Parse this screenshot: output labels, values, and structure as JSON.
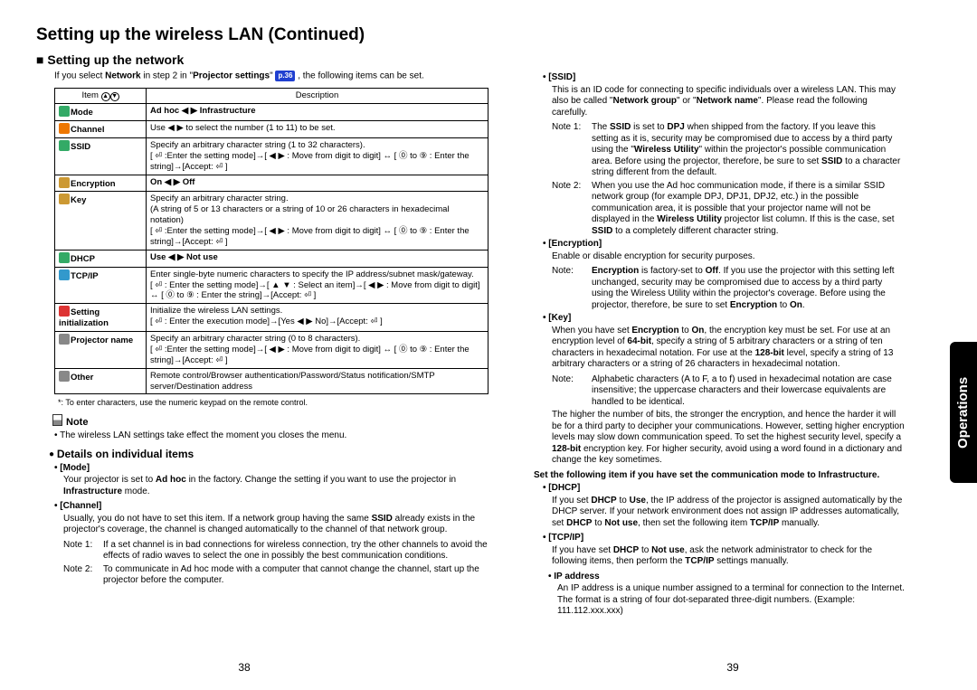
{
  "title": "Setting up the wireless LAN (Continued)",
  "subheading": "Setting up the network",
  "intro_prefix": "If you select ",
  "intro_bold1": "Network",
  "intro_mid": " in step 2 in \"",
  "intro_bold2": "Projector settings",
  "intro_after_quote": "\" ",
  "page_ref": "p.36",
  "intro_suffix": " , the following items can be set.",
  "table": {
    "head_item": "Item",
    "head_desc": "Description",
    "rows": [
      {
        "item": "Mode",
        "desc": "Ad hoc ◀ ▶ Infrastructure",
        "bold": true,
        "icon": "mode"
      },
      {
        "item": "Channel",
        "desc": "Use ◀ ▶ to select the number (1 to 11) to be set.",
        "icon": "channel"
      },
      {
        "item": "SSID",
        "desc": "Specify an arbitrary character string (1 to 32 characters).\n[ ⏎ :Enter the setting mode]→[ ◀ ▶ : Move from digit to digit] ↔ [ ⓪ to ⑨ : Enter the string]→[Accept: ⏎ ]",
        "icon": "ssid"
      },
      {
        "item": "Encryption",
        "desc": "On ◀ ▶ Off",
        "bold": true,
        "icon": "encryption"
      },
      {
        "item": "Key",
        "desc": "Specify an arbitrary character string.\n(A string of 5 or 13 characters or a string of 10 or 26 characters in hexadecimal notation)\n[ ⏎ :Enter the setting mode]→[ ◀ ▶ : Move from digit to digit] ↔ [ ⓪ to ⑨ : Enter the string]→[Accept: ⏎ ]",
        "icon": "key"
      },
      {
        "item": "DHCP",
        "desc": "Use ◀ ▶ Not use",
        "bold": true,
        "icon": "dhcp"
      },
      {
        "item": "TCP/IP",
        "desc": "Enter single-byte numeric characters to specify the IP address/subnet mask/gateway.\n[ ⏎ : Enter the setting mode]→[ ▲ ▼ : Select an item]→[ ◀ ▶ : Move from digit to digit] ↔ [ ⓪ to ⑨ : Enter the string]→[Accept: ⏎ ]",
        "icon": "tcpip"
      },
      {
        "item": "Setting initialization",
        "desc": "Initialize the wireless LAN settings.\n[ ⏎ : Enter the execution mode]→[Yes ◀ ▶ No]→[Accept: ⏎ ]",
        "icon": "init"
      },
      {
        "item": "Projector name",
        "desc": "Specify an arbitrary character string (0 to 8 characters).\n[ ⏎ :Enter the setting mode]→[ ◀ ▶ : Move from digit to digit] ↔ [ ⓪ to ⑨ : Enter the string]→[Accept: ⏎ ]",
        "icon": "projector"
      },
      {
        "item": "Other",
        "desc": "Remote control/Browser authentication/Password/Status notification/SMTP server/Destination address",
        "icon": "other"
      }
    ]
  },
  "footnote": "*: To enter characters, use the numeric keypad on the remote control.",
  "note_heading": "Note",
  "note_text": "• The wireless LAN settings take effect the moment you closes the menu.",
  "details_heading": "Details on individual items",
  "left_details": [
    {
      "h": "[Mode]",
      "p": "Your projector is set to <b>Ad hoc</b> in the factory. Change the setting if you want to use the projector in <b>Infrastructure</b> mode."
    },
    {
      "h": "[Channel]",
      "p": "Usually, you do not have to set this item. If a network group having the same <b>SSID</b> already exists in the projector's coverage, the channel is changed automatically to the channel of that network group.",
      "notes": [
        {
          "label": "Note 1:",
          "t": "If a set channel is in bad connections for wireless connection, try the other channels to avoid the effects of radio waves to select the one in possibly the best communication conditions."
        },
        {
          "label": "Note 2:",
          "t": "To communicate in Ad hoc mode with a computer that cannot change the channel, start up the projector before the computer."
        }
      ]
    }
  ],
  "right_details": [
    {
      "h": "[SSID]",
      "p": "This is an ID code for connecting to specific individuals over a wireless LAN. This may also be called \"<b>Network group</b>\" or \"<b>Network name</b>\". Please read the following carefully.",
      "notes": [
        {
          "label": "Note 1:",
          "t": "The <b>SSID</b> is set to <b>DPJ</b> when shipped from the factory. If you leave this setting as it is, security may be compromised due to access by a third party using the \"<b>Wireless Utility</b>\" within the projector's possible communication area. Before using the projector, therefore, be sure to set <b>SSID</b> to a character string different from the default."
        },
        {
          "label": "Note 2:",
          "t": "When you use the Ad hoc communication mode, if there is a similar SSID network group (for example DPJ, DPJ1, DPJ2, etc.) in the possible communication area, it is possible that your projector name will not be displayed in the <b>Wireless Utility</b> projector list column. If this is the case, set <b>SSID</b> to a completely different character string."
        }
      ]
    },
    {
      "h": "[Encryption]",
      "p": "Enable or disable encryption for security purposes.",
      "notes": [
        {
          "label": "Note:",
          "t": "<b>Encryption</b> is factory-set to <b>Off</b>. If you use the projector with this setting left unchanged, security may be compromised due to access by a third party using the Wireless Utility within the projector's coverage. Before using the projector, therefore, be sure to set <b>Encryption</b> to <b>On</b>."
        }
      ]
    },
    {
      "h": "[Key]",
      "p": "When you have set <b>Encryption</b> to <b>On</b>, the encryption key must be set. For use at an encryption level of <b>64-bit</b>, specify a string of 5 arbitrary characters or a string of ten characters in hexadecimal notation. For use at the <b>128-bit</b> level, specify a string of 13 arbitrary characters or a string of 26 characters in hexadecimal notation.",
      "notes": [
        {
          "label": "Note:",
          "t": "Alphabetic characters (A to F, a to f) used in hexadecimal notation are case insensitive; the uppercase characters and their lowercase equivalents are handled to be identical."
        }
      ],
      "after": "The higher the number of bits, the stronger the encryption, and hence the harder it will be for a third party to decipher your communications. However, setting higher encryption levels may slow down communication speed. To set the highest security level, specify a <b>128-bit</b> encryption key. For higher security, avoid using a word found in a dictionary and change the key sometimes."
    },
    {
      "infra_line": "Set the following item if you have set the communication mode to Infrastructure."
    },
    {
      "h": "[DHCP]",
      "p": "If you set <b>DHCP</b> to <b>Use</b>, the IP address of the projector is assigned automatically by the DHCP server. If your network environment does not assign IP addresses automatically, set <b>DHCP</b> to <b>Not use</b>, then set the following item <b>TCP/IP</b> manually."
    },
    {
      "h": "[TCP/IP]",
      "p": "If you have set <b>DHCP</b> to <b>Not use</b>, ask the network administrator to check for the following items, then perform the <b>TCP/IP</b> settings manually.",
      "sub": {
        "h": "IP address",
        "p": "An IP address is a unique number assigned to a terminal for connection to the Internet. The format is a string of four dot-separated three-digit numbers. (Example: 111.112.xxx.xxx)"
      }
    }
  ],
  "side_tab": "Operations",
  "page_left": "38",
  "page_right": "39"
}
